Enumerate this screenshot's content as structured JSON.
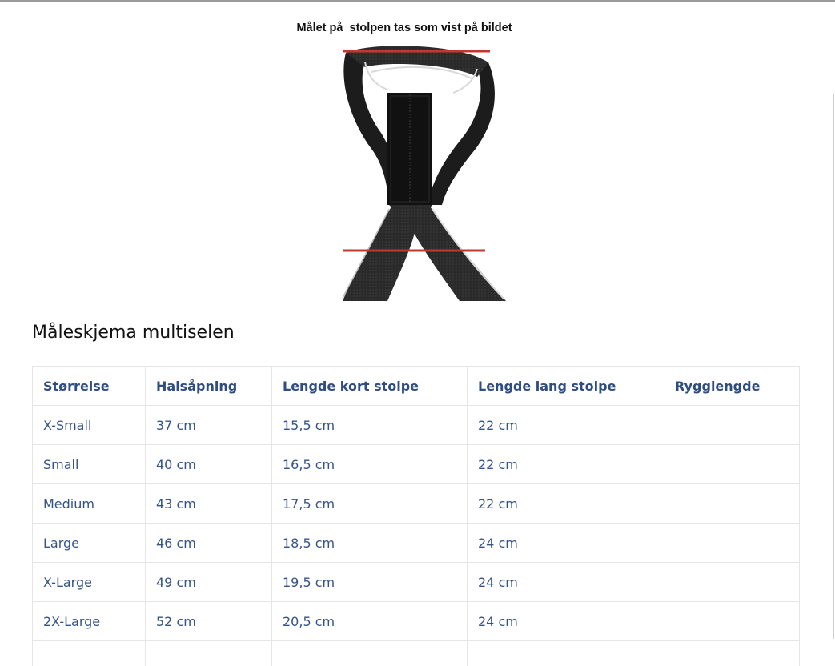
{
  "figure": {
    "caption": "Målet på  stolpen tas som vist på bildet",
    "image_icon": "dog-harness-photo-icon",
    "measure_line_color": "#c0392b"
  },
  "chart": {
    "title": "Måleskjema multiselen",
    "headers": [
      "Størrelse",
      "Halsåpning",
      "Lengde kort stolpe",
      "Lengde lang stolpe",
      "Rygglengde"
    ],
    "rows": [
      [
        "X-Small",
        "37 cm",
        "15,5 cm",
        "22 cm",
        ""
      ],
      [
        "Small",
        "40 cm",
        "16,5 cm",
        "22 cm",
        ""
      ],
      [
        "Medium",
        "43 cm",
        "17,5 cm",
        "22 cm",
        ""
      ],
      [
        "Large",
        "46 cm",
        "18,5 cm",
        "24 cm",
        ""
      ],
      [
        "X-Large",
        "49 cm",
        "19,5 cm",
        "24 cm",
        ""
      ],
      [
        "2X-Large",
        "52 cm",
        "20,5 cm",
        "24 cm",
        ""
      ],
      [
        "",
        "",
        "",
        "",
        ""
      ]
    ]
  },
  "colors": {
    "table_text": "#34538a",
    "table_border": "#e6e6e6"
  }
}
